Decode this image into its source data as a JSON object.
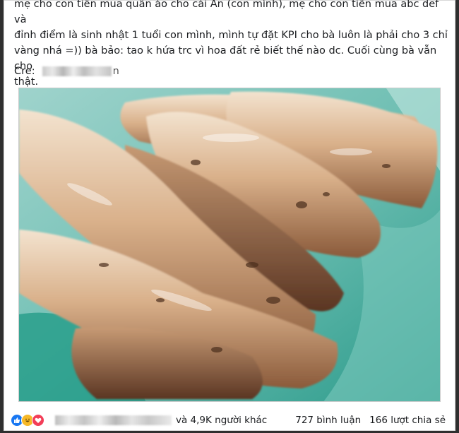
{
  "post": {
    "text_lines": [
      "mẹ cho con tiền mua quần áo cho cái An (con mình), mẹ cho con tiền mua abc def và",
      "đỉnh điểm là sinh nhật 1 tuổi con mình, mình tự đặt KPI cho bà luôn là phải cho 3 chỉ",
      "vàng nhá =)) bà bảo: tao k hứa trc vì hoa đất rẻ biết thế nào dc. Cuối cùng bà vẫn cho",
      "thật."
    ],
    "cre_label": "Cre:",
    "cre_tail": "n"
  },
  "footer": {
    "others": "và 4,9K người khác",
    "comments": "727 bình luận",
    "shares": "166 lượt chia sẻ"
  },
  "colors": {
    "like": "#1877f2",
    "haha": "#f7b928",
    "love": "#f33e58"
  },
  "icons": [
    "like-icon",
    "haha-icon",
    "love-icon"
  ]
}
